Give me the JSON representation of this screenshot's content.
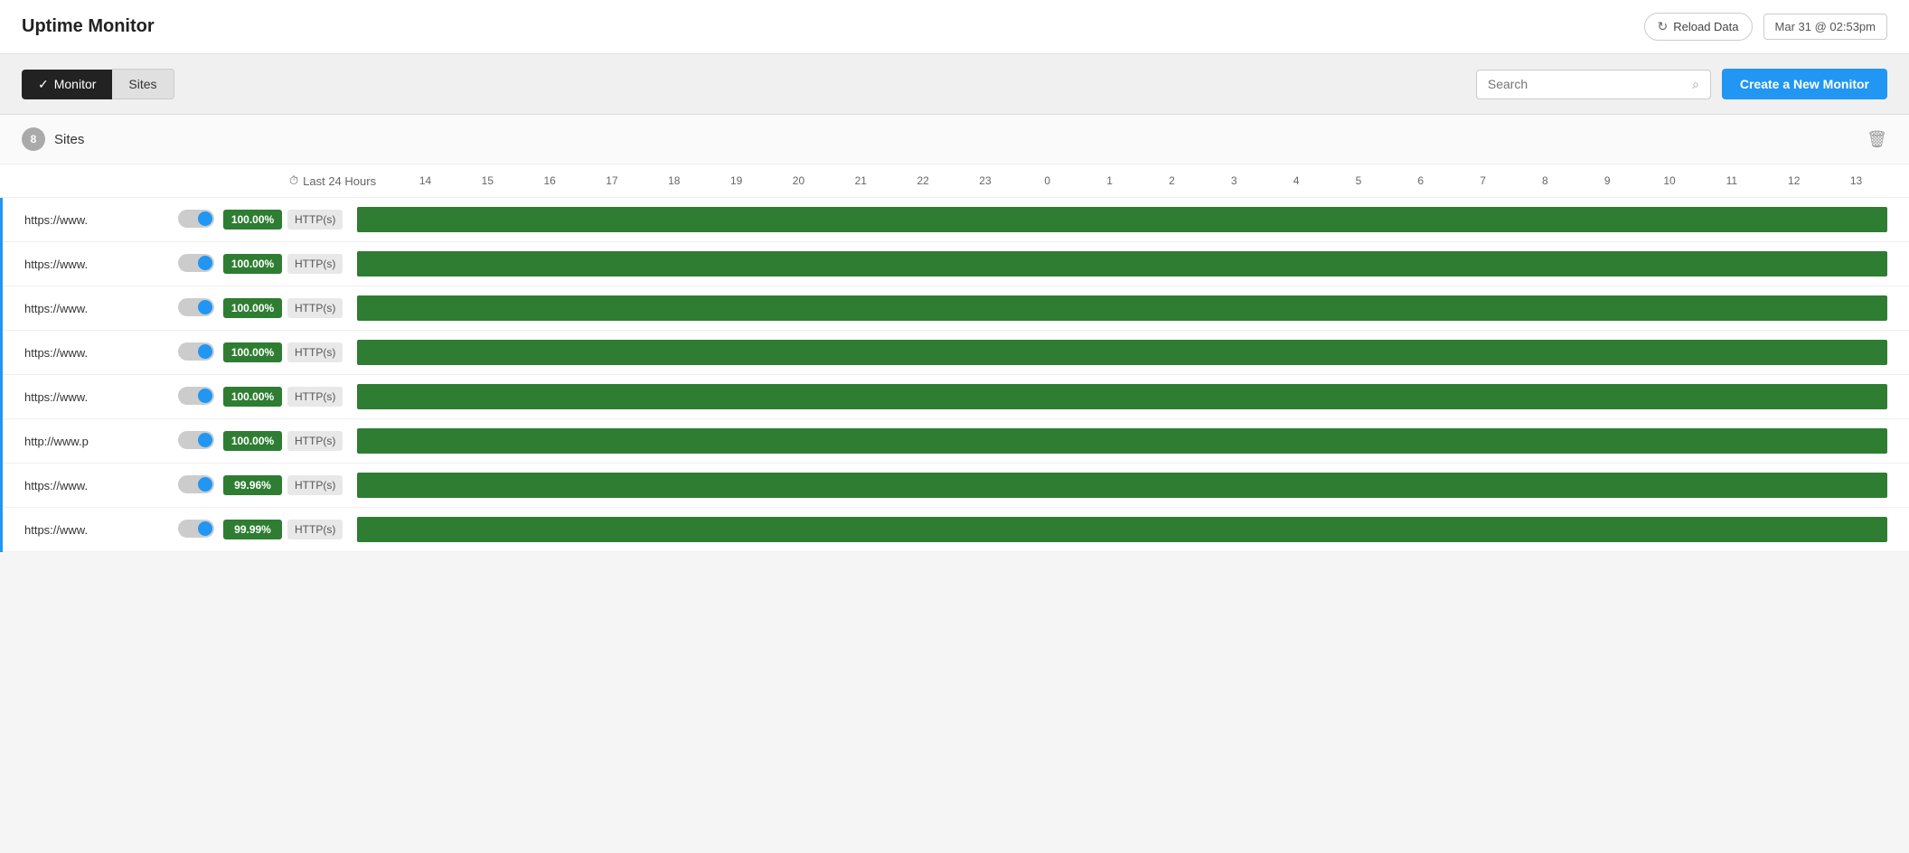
{
  "header": {
    "title": "Uptime Monitor",
    "reload_label": "Reload Data",
    "timestamp": "Mar 31 @ 02:53pm"
  },
  "toolbar": {
    "tab_monitor": "Monitor",
    "tab_sites": "Sites",
    "search_placeholder": "Search",
    "create_button": "Create a New Monitor"
  },
  "section": {
    "count": "8",
    "title": "Sites"
  },
  "time_label": "Last 24 Hours",
  "hours": [
    "14",
    "15",
    "16",
    "17",
    "18",
    "19",
    "20",
    "21",
    "22",
    "23",
    "0",
    "1",
    "2",
    "3",
    "4",
    "5",
    "6",
    "7",
    "8",
    "9",
    "10",
    "11",
    "12",
    "13"
  ],
  "monitors": [
    {
      "url": "https://www.",
      "uptime": "100.00%",
      "protocol": "HTTP(s)",
      "bar_color": "#2e7d32"
    },
    {
      "url": "https://www.",
      "uptime": "100.00%",
      "protocol": "HTTP(s)",
      "bar_color": "#2e7d32"
    },
    {
      "url": "https://www.",
      "uptime": "100.00%",
      "protocol": "HTTP(s)",
      "bar_color": "#2e7d32"
    },
    {
      "url": "https://www.",
      "uptime": "100.00%",
      "protocol": "HTTP(s)",
      "bar_color": "#2e7d32"
    },
    {
      "url": "https://www.",
      "uptime": "100.00%",
      "protocol": "HTTP(s)",
      "bar_color": "#2e7d32"
    },
    {
      "url": "http://www.p",
      "uptime": "100.00%",
      "protocol": "HTTP(s)",
      "bar_color": "#2e7d32"
    },
    {
      "url": "https://www.",
      "uptime": "99.96%",
      "protocol": "HTTP(s)",
      "bar_color": "#2e7d32"
    },
    {
      "url": "https://www.",
      "uptime": "99.99%",
      "protocol": "HTTP(s)",
      "bar_color": "#2e7d32"
    }
  ]
}
